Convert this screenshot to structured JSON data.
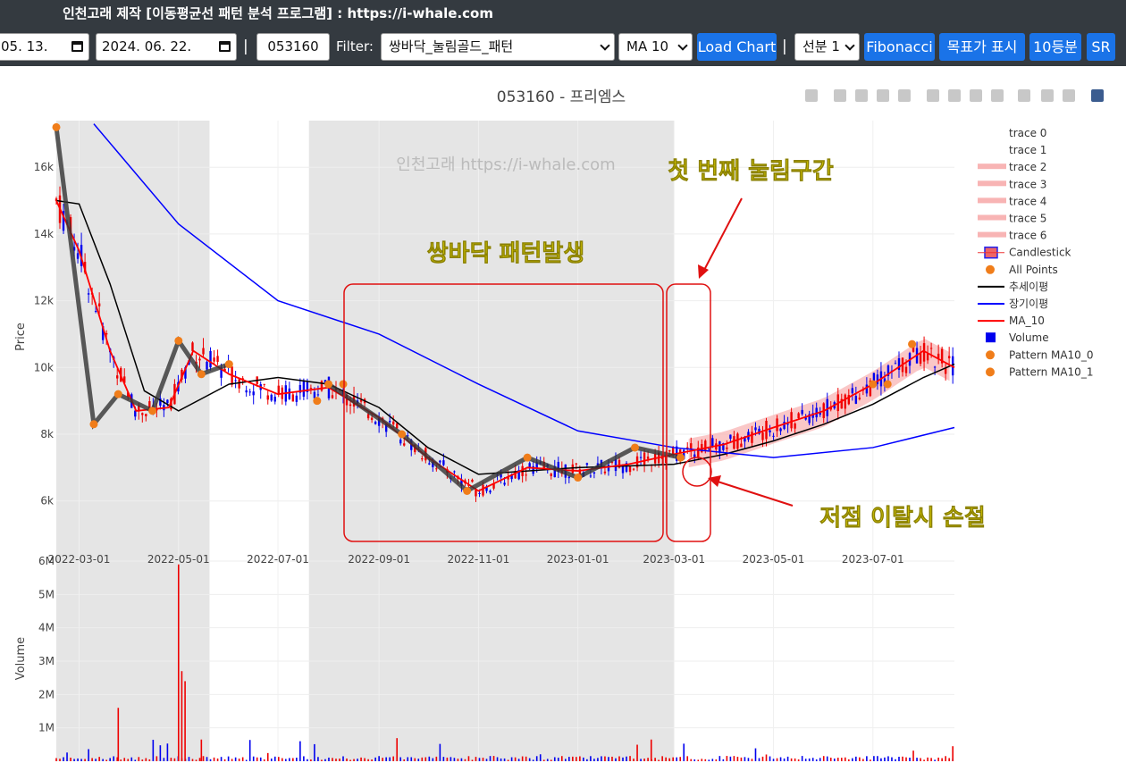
{
  "window": {
    "title": "인천고래 제작 [이동평균선 패턴 분석 프로그램] : https://i-whale.com"
  },
  "toolbar": {
    "start_date": "05. 13.",
    "end_date": "2024. 06. 22.",
    "separator": "|",
    "code_value": "053160",
    "filter_label": "Filter:",
    "filter_value": "쌍바닥_눌림골드_패턴",
    "ma_value": "MA 10",
    "load_label": "Load Chart",
    "line_value": "선분 1",
    "fibonacci_label": "Fibonacci",
    "target_label": "목표가 표시",
    "split_label": "10등분",
    "sr_label": "SR"
  },
  "chart": {
    "title": "053160 - 프리엠스",
    "watermark": "인천고래 https://i-whale.com",
    "modebar_icons": [
      "camera-icon",
      "zoom-icon",
      "pan-icon",
      "box-select-icon",
      "lasso-icon",
      "zoom-in-icon",
      "zoom-out-icon",
      "autoscale-icon",
      "home-icon",
      "spike-icon",
      "hover-closest-icon",
      "hover-compare-icon",
      "plotly-logo-icon"
    ],
    "annotations": {
      "double_bottom": "쌍바닥 패턴발생",
      "first_pullback": "첫 번째 눌림구간",
      "stop_loss": "저점 이탈시 손절"
    },
    "accent_color": "#1a73e8",
    "annotation_color": "#e6d800"
  },
  "chart_data": [
    {
      "type": "candlestick",
      "ylabel": "Price",
      "y_ticks": [
        "6k",
        "8k",
        "10k",
        "12k",
        "14k",
        "16k"
      ],
      "x_ticks": [
        "2022-03-01",
        "2022-05-01",
        "2022-07-01",
        "2022-09-01",
        "2022-11-01",
        "2023-01-01",
        "2023-03-01",
        "2023-05-01",
        "2023-07-01"
      ],
      "ylim": [
        5000,
        17500
      ],
      "shaded_ranges": [
        [
          "2022-02-15",
          "2022-05-20"
        ],
        [
          "2022-07-20",
          "2023-03-01"
        ]
      ],
      "series": [
        {
          "name": "추세이평",
          "color": "#000000",
          "x": [
            "2022-02-15",
            "2022-03-01",
            "2022-03-20",
            "2022-04-10",
            "2022-05-01",
            "2022-06-01",
            "2022-07-01",
            "2022-08-01",
            "2022-09-01",
            "2022-10-01",
            "2022-11-01",
            "2022-12-01",
            "2023-01-01",
            "2023-02-01",
            "2023-03-01",
            "2023-04-01",
            "2023-05-01",
            "2023-06-01",
            "2023-07-01",
            "2023-08-01",
            "2023-08-20"
          ],
          "values": [
            15000,
            14900,
            12500,
            9300,
            8700,
            9500,
            9700,
            9500,
            8800,
            7600,
            6800,
            6900,
            7000,
            7050,
            7100,
            7400,
            7800,
            8300,
            8900,
            9700,
            10100
          ]
        },
        {
          "name": "장기이평",
          "color": "#0000ff",
          "x": [
            "2022-03-10",
            "2022-05-01",
            "2022-07-01",
            "2022-09-01",
            "2022-11-01",
            "2023-01-01",
            "2023-03-01",
            "2023-05-01",
            "2023-07-01",
            "2023-08-20"
          ],
          "values": [
            17300,
            14300,
            12000,
            11000,
            9500,
            8100,
            7600,
            7300,
            7600,
            8200
          ]
        },
        {
          "name": "MA_10",
          "color": "#ff0000",
          "x": [
            "2022-02-15",
            "2022-03-01",
            "2022-03-20",
            "2022-04-05",
            "2022-04-25",
            "2022-05-10",
            "2022-06-01",
            "2022-07-01",
            "2022-08-01",
            "2022-09-01",
            "2022-10-01",
            "2022-11-01",
            "2022-12-01",
            "2023-01-01",
            "2023-02-01",
            "2023-03-01",
            "2023-04-01",
            "2023-05-01",
            "2023-06-01",
            "2023-07-01",
            "2023-08-01",
            "2023-08-20"
          ],
          "values": [
            15000,
            13500,
            10500,
            8700,
            8800,
            10500,
            9800,
            9200,
            9400,
            8500,
            7300,
            6300,
            7000,
            6900,
            7100,
            7400,
            7700,
            8200,
            8700,
            9500,
            10500,
            10000
          ]
        },
        {
          "name": "Pattern MA10_0",
          "color": "#444444",
          "x": [
            "2022-02-15",
            "2022-03-10",
            "2022-03-25",
            "2022-04-15",
            "2022-05-01",
            "2022-05-15",
            "2022-06-01"
          ],
          "values": [
            17200,
            8300,
            9200,
            8700,
            10800,
            9800,
            10100
          ]
        },
        {
          "name": "Pattern MA10_1",
          "color": "#444444",
          "x": [
            "2022-08-01",
            "2022-09-15",
            "2022-10-25",
            "2022-12-01",
            "2023-01-01",
            "2023-02-05",
            "2023-03-05"
          ],
          "values": [
            9500,
            8000,
            6300,
            7300,
            6700,
            7600,
            7300
          ]
        }
      ],
      "legend": [
        "trace 0",
        "trace 1",
        "trace 2",
        "trace 3",
        "trace 4",
        "trace 5",
        "trace 6",
        "Candlestick",
        "All Points",
        "추세이평",
        "장기이평",
        "MA_10",
        "Volume",
        "Pattern MA10_0",
        "Pattern MA10_1"
      ],
      "legend_placement": "right"
    },
    {
      "type": "bar",
      "ylabel": "Volume",
      "y_ticks": [
        "1M",
        "2M",
        "3M",
        "4M",
        "5M",
        "6M"
      ],
      "ylim": [
        0,
        6000000
      ]
    }
  ]
}
